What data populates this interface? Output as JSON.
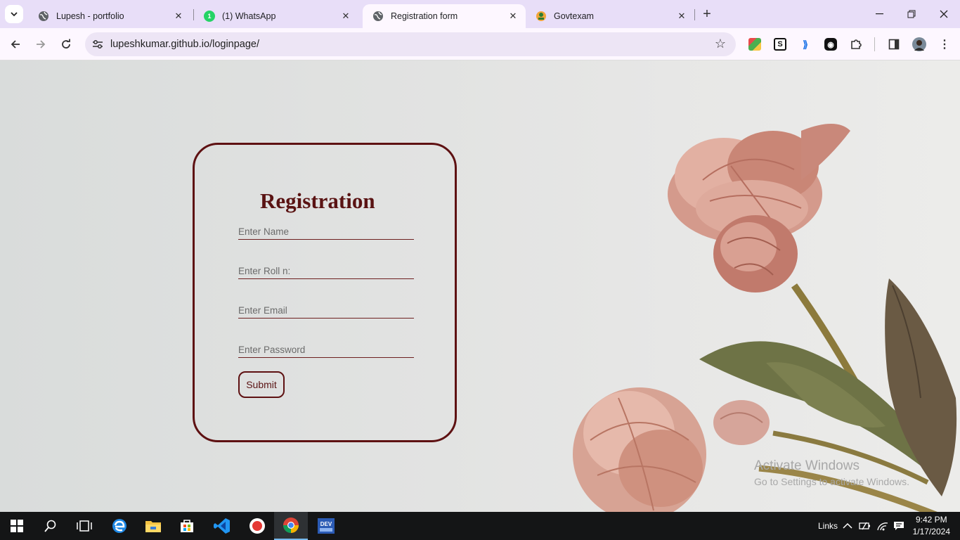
{
  "browser": {
    "tabs": [
      {
        "title": "Lupesh - portfolio",
        "close": "✕"
      },
      {
        "title": "(1) WhatsApp",
        "close": "✕"
      },
      {
        "title": "Registration form",
        "close": "✕"
      },
      {
        "title": "Govtexam",
        "close": "✕"
      }
    ],
    "active_tab_index": 2,
    "url": "lupeshkumar.github.io/loginpage/",
    "extensions": [
      "s-extension-icon",
      "wave-extension-icon",
      "circle-extension-icon"
    ]
  },
  "page": {
    "heading": "Registration",
    "fields": {
      "name": {
        "placeholder": "Enter Name",
        "value": ""
      },
      "roll": {
        "placeholder": "Enter Roll n:",
        "value": ""
      },
      "email": {
        "placeholder": "Enter Email",
        "value": ""
      },
      "password": {
        "placeholder": "Enter Password",
        "value": ""
      }
    },
    "submit_label": "Submit",
    "colors": {
      "accent": "#5e1112"
    }
  },
  "watermark": {
    "line1": "Activate Windows",
    "line2": "Go to Settings to activate Windows."
  },
  "taskbar": {
    "links_label": "Links",
    "time": "9:42 PM",
    "date": "1/17/2024"
  }
}
